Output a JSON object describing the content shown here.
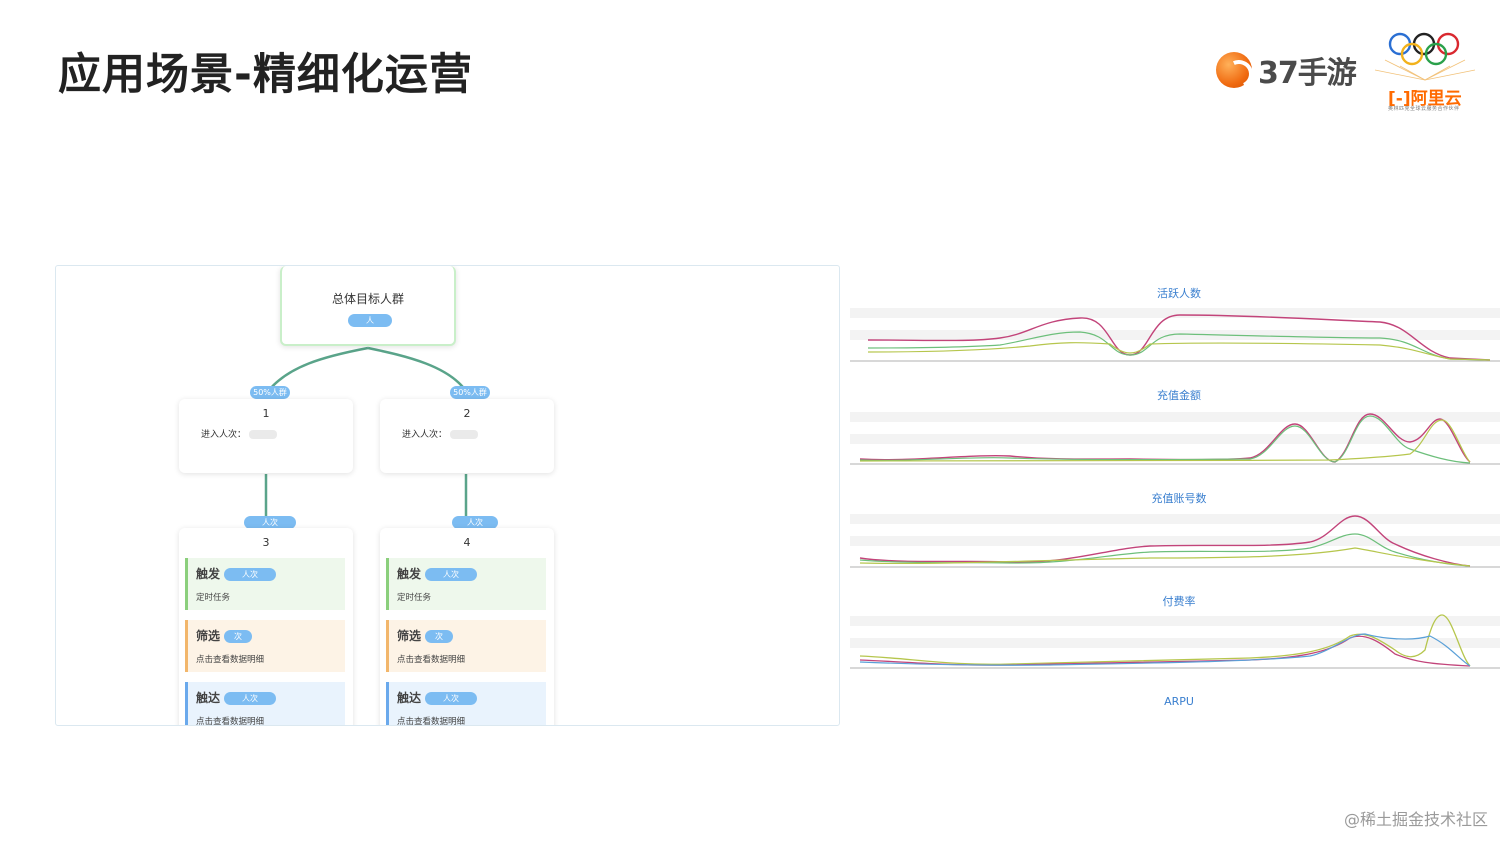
{
  "slide": {
    "title": "应用场景-精细化运营",
    "watermark": "@稀土掘金技术社区"
  },
  "logos": {
    "game_logo_text": "37手游",
    "aliyun_text": "阿里云",
    "aliyun_sub": "奥林匹克全球云服务合作伙伴",
    "aliyun_bracket_icon": "aliyun-bracket-icon",
    "accent": "#ff6a00"
  },
  "flow": {
    "root_title": "总体目标人群",
    "root_pill": "人",
    "branch_pill": "50%人群",
    "nodes": [
      {
        "num": "1",
        "enter_label": "进入人次："
      },
      {
        "num": "2",
        "enter_label": "进入人次："
      },
      {
        "num": "3"
      },
      {
        "num": "4"
      }
    ],
    "lower_pill": "人次",
    "blocks": {
      "trigger": {
        "title": "触发",
        "sub": "定时任务",
        "pill": "人次"
      },
      "filter": {
        "title": "筛选",
        "sub": "点击查看数据明细",
        "pill": "次"
      },
      "reach": {
        "title": "触达",
        "sub": "点击查看数据明细",
        "pill": "人次"
      }
    },
    "colors": {
      "green": "#8bcf7c",
      "orange": "#f2b66b",
      "blue": "#6aa9ec",
      "pill": "#7cbcf2"
    }
  },
  "charts": {
    "titles": [
      "活跃人数",
      "充值金额",
      "充值账号数",
      "付费率",
      "ARPU"
    ],
    "series_colors": [
      "#c2447a",
      "#6dbf7b",
      "#b6c64d",
      "#5aa0d8"
    ]
  }
}
